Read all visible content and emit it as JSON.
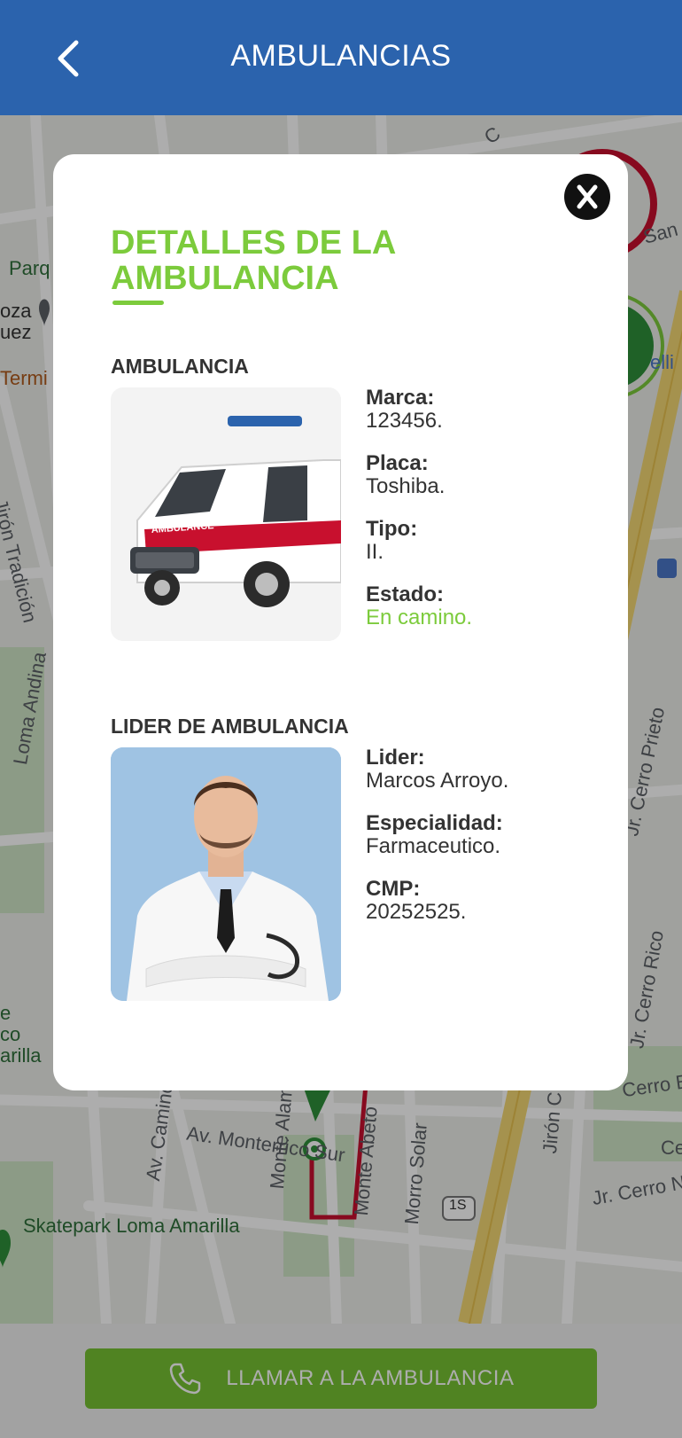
{
  "header": {
    "title": "AMBULANCIAS"
  },
  "map": {
    "labels": {
      "avenue": "Av. Monterrico Sur",
      "park": "Skatepark Loma Amarilla",
      "road1": "Monte Alamo",
      "road2": "Monte Abeto",
      "road3": "Morro Solar",
      "road4": "Av. Caminos del",
      "road5": "Jr. Cerro Prieto",
      "road6": "Loma Andina",
      "road7": "Jirón Tradición",
      "road8": "Jr. Cerro N",
      "road9": "Cerro Blan",
      "road10": "Jirón C",
      "road11": "Jr. Cerro Rico",
      "highway": "1S",
      "frag_parq": "Parq",
      "frag_oza": "oza",
      "frag_uez": "uez",
      "frag_termi": "Termi",
      "frag_san": "San J",
      "frag_elli": "elli",
      "frag_e": "e",
      "frag_co": "co",
      "frag_arilla": "arilla",
      "frag_ce": "Ce",
      "frag_c": "C"
    }
  },
  "modal": {
    "title": "DETALLES DE LA AMBULANCIA",
    "ambulance": {
      "heading": "AMBULANCIA",
      "fields": [
        {
          "label": "Marca:",
          "value": "123456."
        },
        {
          "label": "Placa:",
          "value": "Toshiba."
        },
        {
          "label": "Tipo:",
          "value": "II."
        },
        {
          "label": "Estado:",
          "value": "En camino."
        }
      ],
      "vehicle_text": "AMBULANCE"
    },
    "leader": {
      "heading": "LIDER DE AMBULANCIA",
      "fields": [
        {
          "label": "Lider:",
          "value": "Marcos Arroyo."
        },
        {
          "label": "Especialidad:",
          "value": "Farmaceutico."
        },
        {
          "label": "CMP:",
          "value": "20252525."
        }
      ]
    },
    "close_icon": "close-icon"
  },
  "call_button": {
    "label": "LLAMAR A LA AMBULANCIA",
    "icon": "phone-icon"
  },
  "colors": {
    "header": "#2b63ad",
    "accent": "#7ccb3c",
    "status": "#7ccb3c",
    "button": "#76c233"
  }
}
